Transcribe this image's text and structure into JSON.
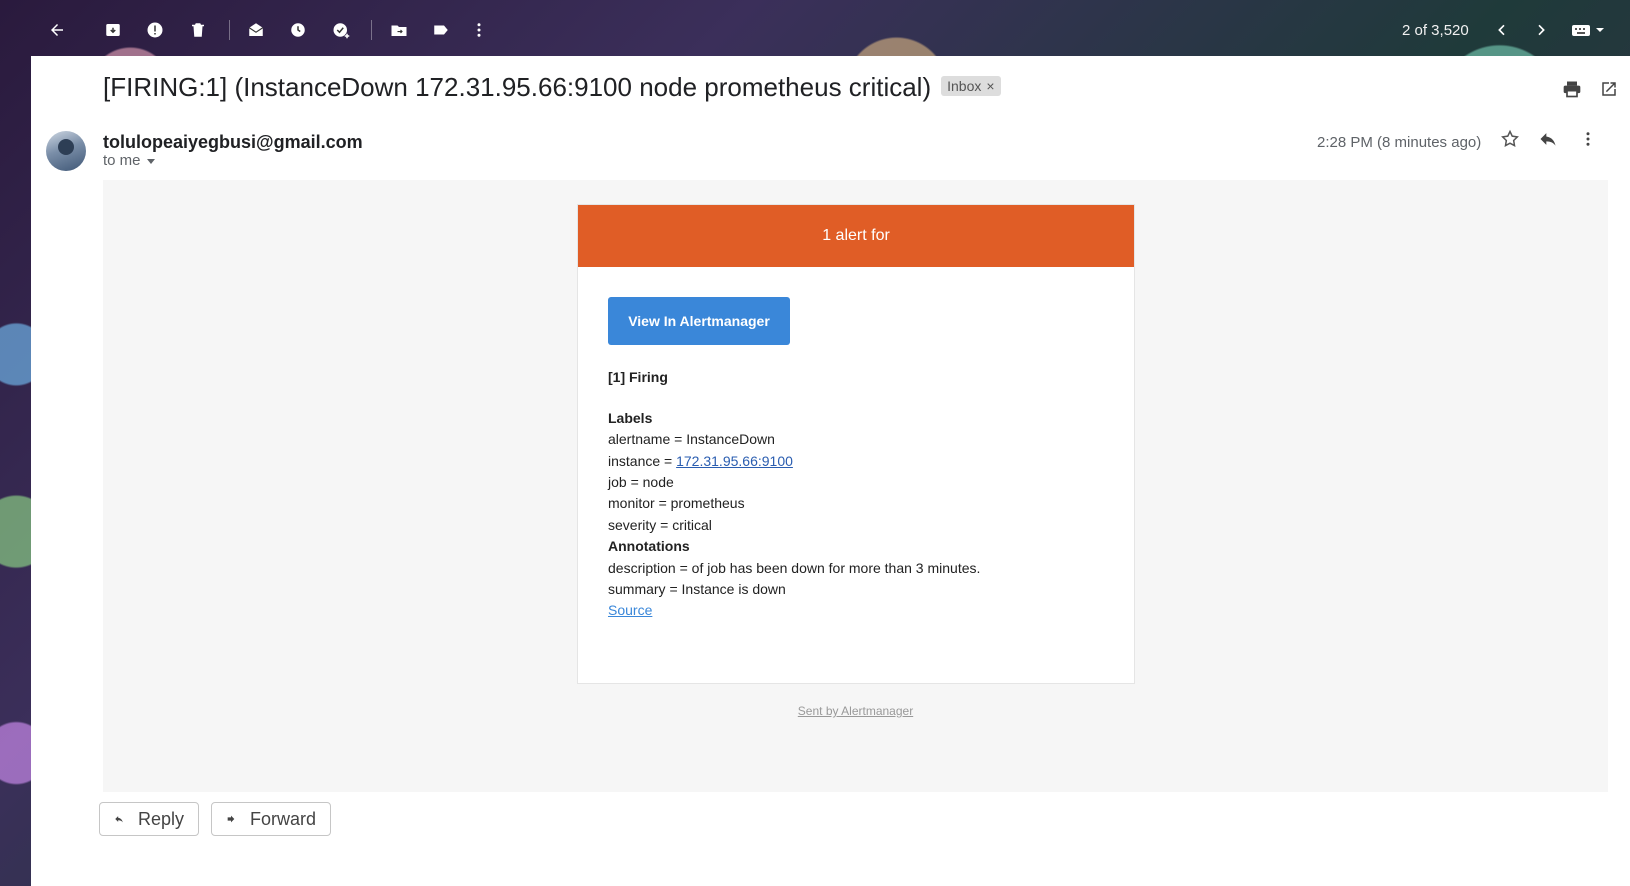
{
  "toolbar": {
    "count": "2 of 3,520",
    "icons": [
      "back-arrow-icon",
      "archive-icon",
      "report-spam-icon",
      "delete-icon",
      "mark-unread-icon",
      "snooze-icon",
      "add-to-tasks-icon",
      "move-to-icon",
      "label-icon",
      "more-vert-icon",
      "chevron-left-icon",
      "chevron-right-icon",
      "keyboard-icon"
    ]
  },
  "message": {
    "subject": "[FIRING:1] (InstanceDown 172.31.95.66:9100 node prometheus critical)",
    "label_chip": "Inbox",
    "label_chip_close": "×",
    "sender": "tolulopeaiyegbusi@gmail.com",
    "recipient": "to me",
    "date": "2:28 PM (8 minutes ago)"
  },
  "email": {
    "header_text": "1 alert for",
    "header_color": "#e05d26",
    "button_label": "View In Alertmanager",
    "button_color": "#3a87d9",
    "firing_title": "[1] Firing",
    "labels_title": "Labels",
    "alertname": "alertname = InstanceDown",
    "instance_prefix": "instance = ",
    "instance_link": "172.31.95.66:9100",
    "job": "job = node",
    "monitor": "monitor = prometheus",
    "severity": "severity = critical",
    "annotations_title": "Annotations",
    "description": "description = of job has been down for more than 3 minutes.",
    "summary": "summary = Instance is down",
    "source_link": "Source",
    "sent_by": "Sent by Alertmanager"
  },
  "actions": {
    "reply": "Reply",
    "forward": "Forward"
  }
}
